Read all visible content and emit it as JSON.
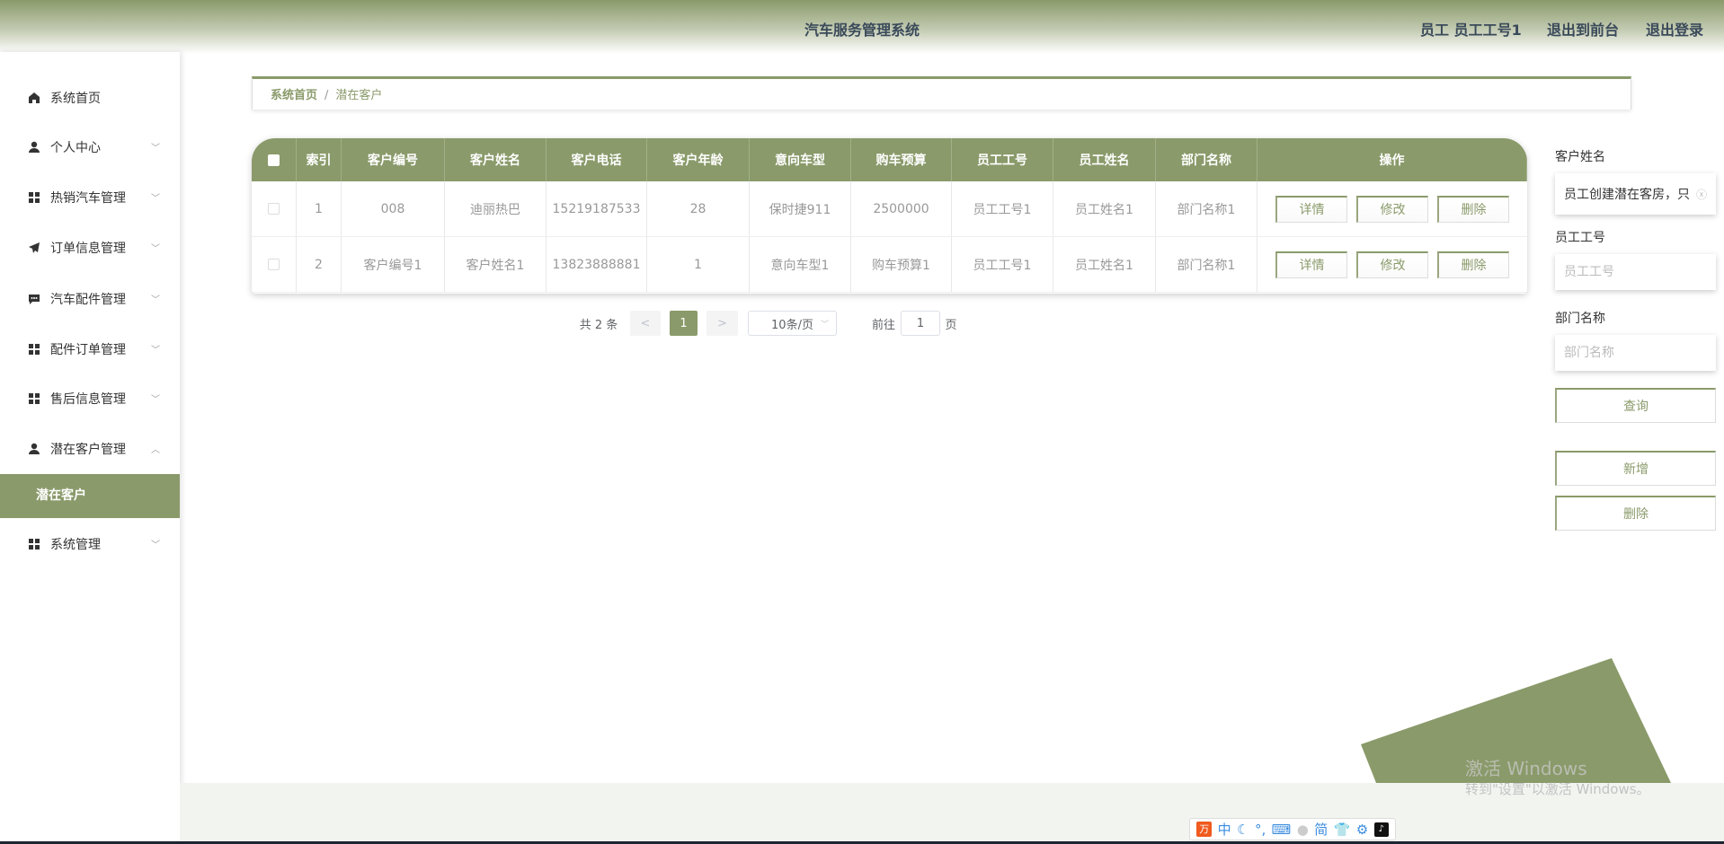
{
  "header": {
    "title": "汽车服务管理系统",
    "user": "员工 员工工号1",
    "to_front": "退出到前台",
    "logout": "退出登录"
  },
  "sidebar": {
    "items": [
      {
        "label": "系统首页",
        "icon": "home-icon"
      },
      {
        "label": "个人中心",
        "icon": "user-icon"
      },
      {
        "label": "热销汽车管理",
        "icon": "grid-icon"
      },
      {
        "label": "订单信息管理",
        "icon": "send-icon"
      },
      {
        "label": "汽车配件管理",
        "icon": "message-icon"
      },
      {
        "label": "配件订单管理",
        "icon": "grid-icon"
      },
      {
        "label": "售后信息管理",
        "icon": "grid-icon"
      },
      {
        "label": "潜在客户管理",
        "icon": "user-icon"
      },
      {
        "label": "系统管理",
        "icon": "grid-icon"
      }
    ],
    "active_sub": "潜在客户"
  },
  "breadcrumb": {
    "home": "系统首页",
    "sep": "/",
    "current": "潜在客户"
  },
  "table": {
    "headers": [
      "索引",
      "客户编号",
      "客户姓名",
      "客户电话",
      "客户年龄",
      "意向车型",
      "购车预算",
      "员工工号",
      "员工姓名",
      "部门名称",
      "操作"
    ],
    "rows": [
      [
        "1",
        "008",
        "迪丽热巴",
        "15219187533",
        "28",
        "保时捷911",
        "2500000",
        "员工工号1",
        "员工姓名1",
        "部门名称1"
      ],
      [
        "2",
        "客户编号1",
        "客户姓名1",
        "13823888881",
        "1",
        "意向车型1",
        "购车预算1",
        "员工工号1",
        "员工姓名1",
        "部门名称1"
      ]
    ],
    "actions": [
      "详情",
      "修改",
      "删除"
    ]
  },
  "pagination": {
    "total": "共 2 条",
    "prev": "<",
    "page": "1",
    "next": ">",
    "size": "10条/页",
    "goto": "前往",
    "goto_value": "1",
    "page_unit": "页"
  },
  "search": {
    "name_label": "客户姓名",
    "name_value": "员工创建潜在客房，只",
    "emp_label": "员工工号",
    "emp_placeholder": "员工工号",
    "dept_label": "部门名称",
    "dept_placeholder": "部门名称",
    "query": "查询",
    "add": "新增",
    "delete": "删除"
  },
  "watermark": {
    "line1": "激活 Windows",
    "line2": "转到\"设置\"以激活 Windows。"
  },
  "ime": {
    "zh": "中",
    "simp": "简"
  },
  "colors": {
    "accent": "#8a9a6a"
  }
}
